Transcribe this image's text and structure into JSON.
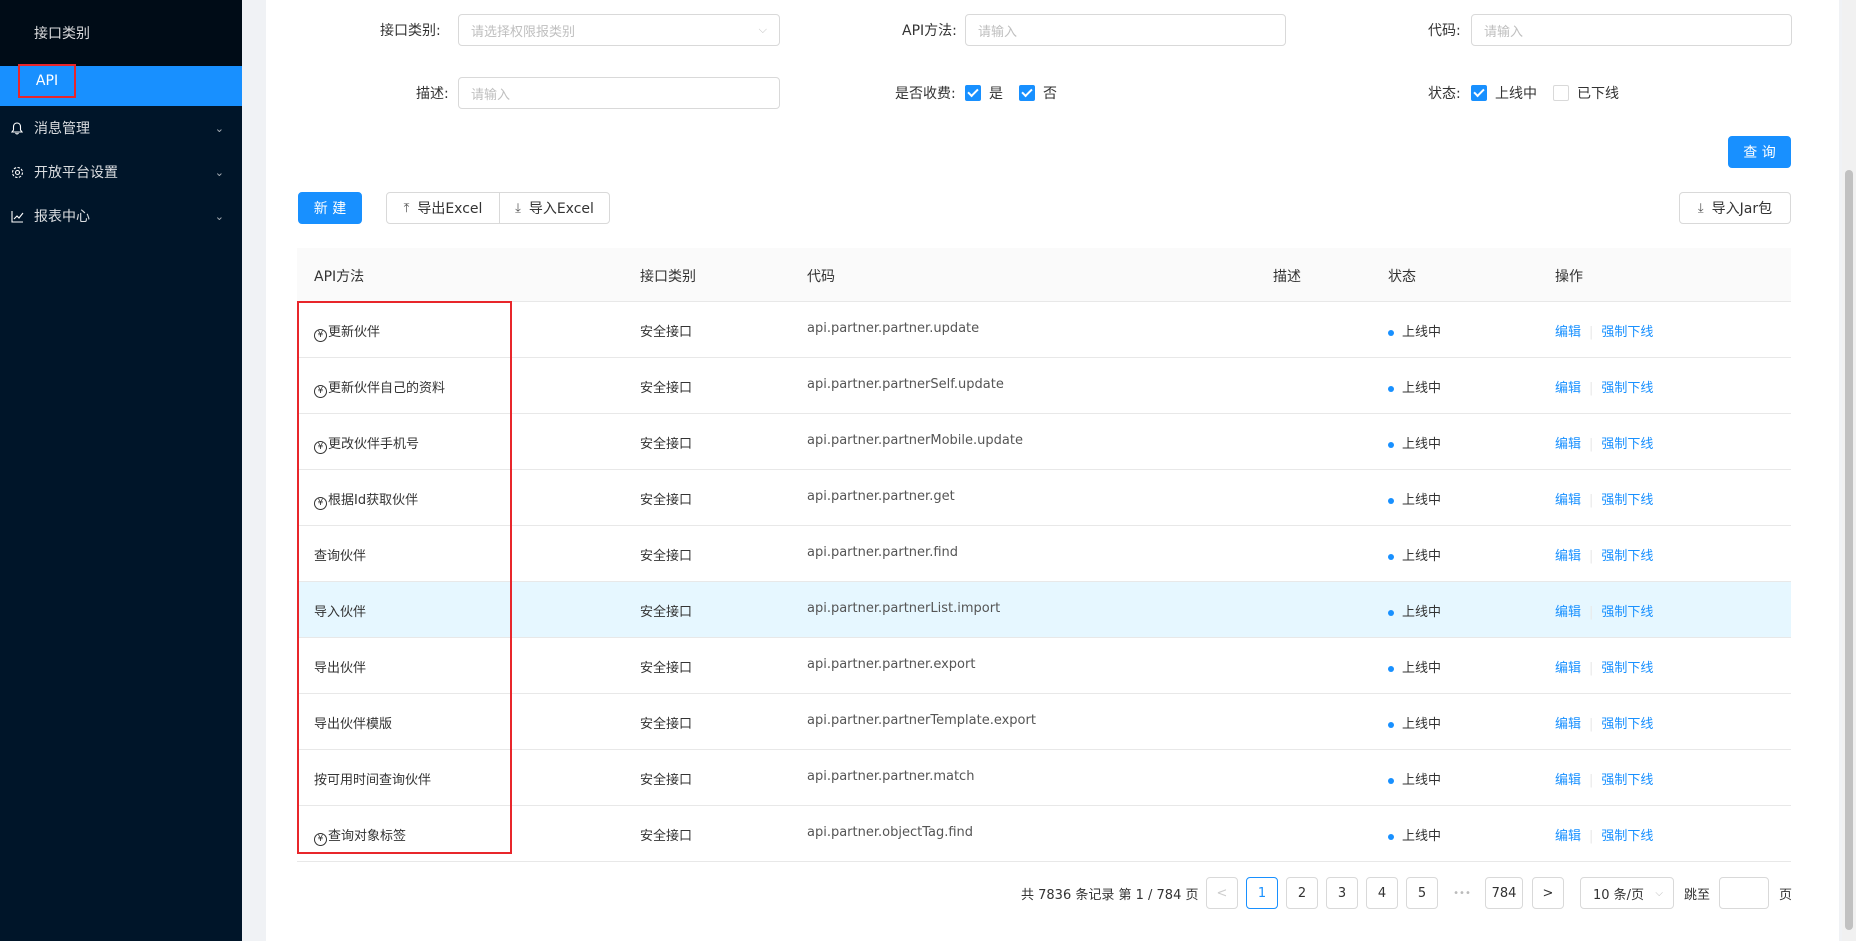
{
  "sidebar": {
    "sub_item": "接口类别",
    "active_item": "API",
    "groups": [
      {
        "label": "消息管理",
        "icon": "bell-icon"
      },
      {
        "label": "开放平台设置",
        "icon": "gear-icon"
      },
      {
        "label": "报表中心",
        "icon": "chart-icon"
      }
    ]
  },
  "filters": {
    "category_label": "接口类别:",
    "category_placeholder": "请选择权限报类别",
    "api_method_label": "API方法:",
    "api_method_placeholder": "请输入",
    "code_label": "代码:",
    "code_placeholder": "请输入",
    "desc_label": "描述:",
    "desc_placeholder": "请输入",
    "charge_label": "是否收费:",
    "charge_yes": "是",
    "charge_no": "否",
    "status_label": "状态:",
    "status_online": "上线中",
    "status_offline": "已下线",
    "query_button": "查 询"
  },
  "toolbar": {
    "new_button": "新 建",
    "export_excel": "导出Excel",
    "import_excel": "导入Excel",
    "import_jar": "导入Jar包"
  },
  "table": {
    "headers": [
      "API方法",
      "接口类别",
      "代码",
      "描述",
      "状态",
      "操作"
    ],
    "rows": [
      {
        "method": "更新伙伴",
        "charged": true,
        "category": "安全接口",
        "code": "api.partner.partner.update",
        "desc": "",
        "status": "上线中"
      },
      {
        "method": "更新伙伴自己的资料",
        "charged": true,
        "category": "安全接口",
        "code": "api.partner.partnerSelf.update",
        "desc": "",
        "status": "上线中"
      },
      {
        "method": "更改伙伴手机号",
        "charged": true,
        "category": "安全接口",
        "code": "api.partner.partnerMobile.update",
        "desc": "",
        "status": "上线中"
      },
      {
        "method": "根据Id获取伙伴",
        "charged": true,
        "category": "安全接口",
        "code": "api.partner.partner.get",
        "desc": "",
        "status": "上线中"
      },
      {
        "method": "查询伙伴",
        "charged": false,
        "category": "安全接口",
        "code": "api.partner.partner.find",
        "desc": "",
        "status": "上线中"
      },
      {
        "method": "导入伙伴",
        "charged": false,
        "category": "安全接口",
        "code": "api.partner.partnerList.import",
        "desc": "",
        "status": "上线中"
      },
      {
        "method": "导出伙伴",
        "charged": false,
        "category": "安全接口",
        "code": "api.partner.partner.export",
        "desc": "",
        "status": "上线中"
      },
      {
        "method": "导出伙伴模版",
        "charged": false,
        "category": "安全接口",
        "code": "api.partner.partnerTemplate.export",
        "desc": "",
        "status": "上线中"
      },
      {
        "method": "按可用时间查询伙伴",
        "charged": false,
        "category": "安全接口",
        "code": "api.partner.partner.match",
        "desc": "",
        "status": "上线中"
      },
      {
        "method": "查询对象标签",
        "charged": true,
        "category": "安全接口",
        "code": "api.partner.objectTag.find",
        "desc": "",
        "status": "上线中"
      }
    ],
    "action_edit": "编辑",
    "action_offline": "强制下线",
    "yen_symbol": "¥"
  },
  "pagination": {
    "summary": "共 7836 条记录 第 1 / 784 页",
    "pages": [
      "1",
      "2",
      "3",
      "4",
      "5"
    ],
    "ellipsis": "•••",
    "last_page": "784",
    "page_size": "10 条/页",
    "jump_label": "跳至",
    "jump_suffix": "页",
    "prev": "<",
    "next": ">"
  },
  "colors": {
    "primary": "#1890ff",
    "sidebar": "#001529",
    "highlight": "#e8262b"
  }
}
